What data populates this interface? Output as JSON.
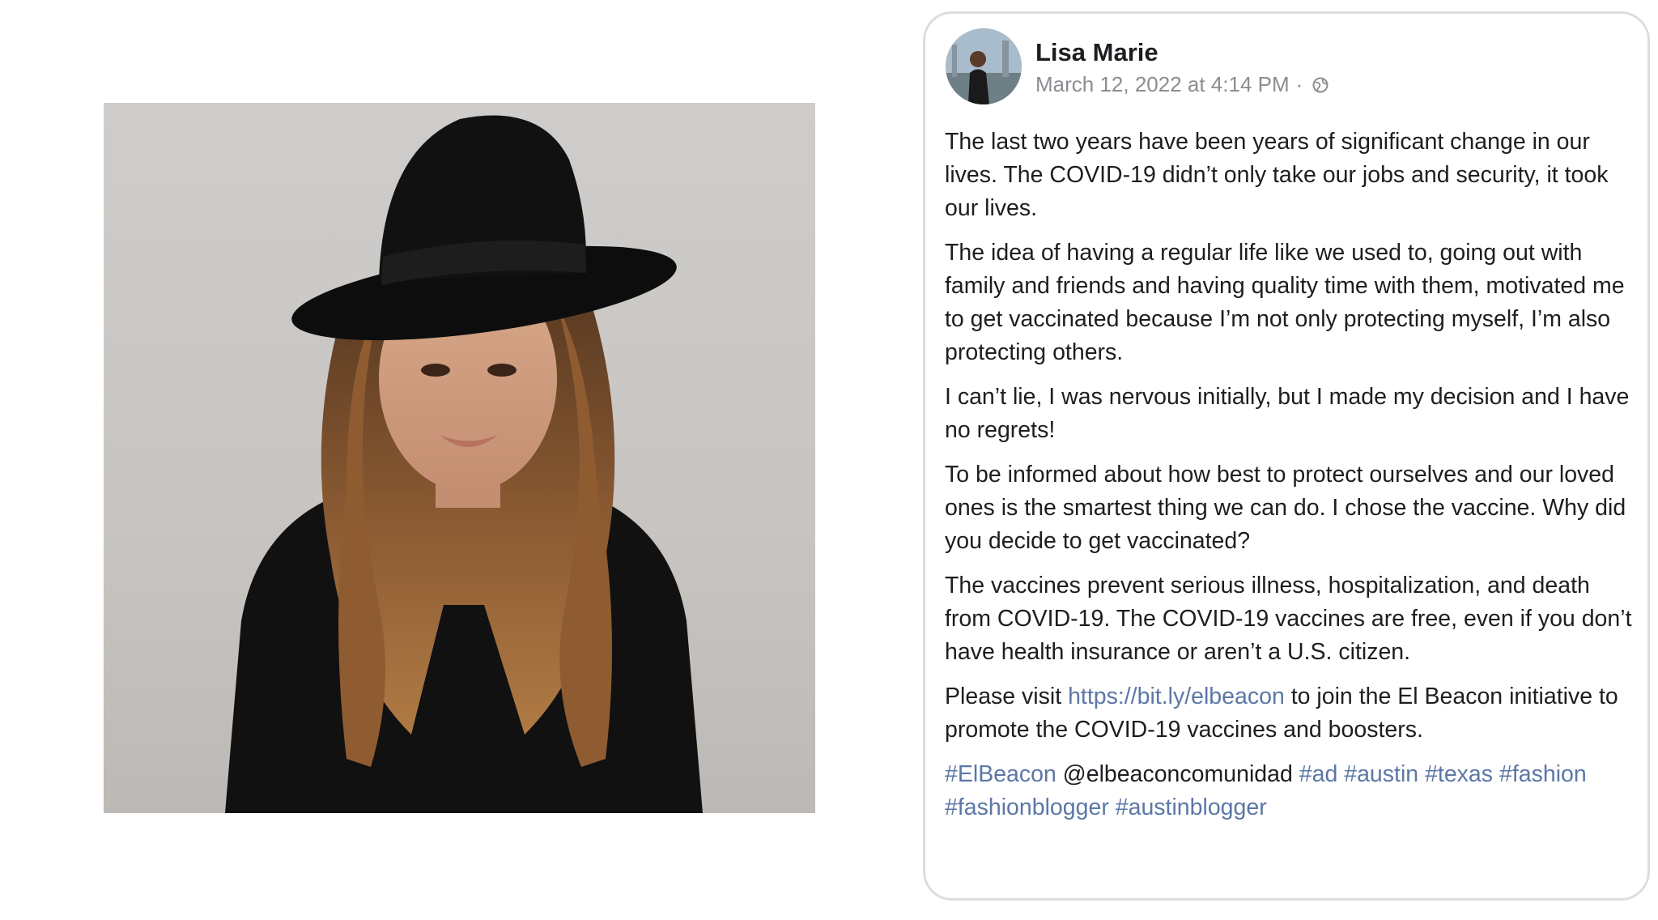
{
  "post": {
    "author": "Lisa Marie",
    "timestamp": "March 12, 2022 at 4:14 PM",
    "meta_separator": "·",
    "privacy_icon": "globe-icon",
    "paragraphs": [
      "The last two years have been years of significant change in our lives. The COVID-19 didn’t only take our jobs and security, it took our lives.",
      "The idea of having a regular life like we used to, going out with family and friends and having quality time with them, motivated me to get vaccinated because I’m not only protecting myself, I’m also protecting others.",
      "I can’t lie, I was nervous initially, but I made my decision and I have no regrets!",
      "To be informed about how best to protect ourselves and our loved ones is the smartest thing we can do. I chose the vaccine. Why did you decide to get vaccinated?",
      "The vaccines prevent serious illness, hospitalization, and death from COVID-19. The COVID-19 vaccines are free, even if you don’t have health insurance or aren’t a U.S. citizen."
    ],
    "cta_before": "Please visit ",
    "cta_link": "https://bit.ly/elbeacon",
    "cta_after": " to join the El Beacon initiative to promote the COVID-19 vaccines and boosters.",
    "tags": {
      "t1": "#ElBeacon",
      "mention": "@elbeaconcomunidad",
      "t2": "#ad",
      "t3": "#austin",
      "t4": "#texas",
      "t5": "#fashion",
      "t6": "#fashionblogger",
      "t7": "#austinblogger"
    }
  },
  "colors": {
    "link": "#5c77a6",
    "text": "#1c1e21",
    "meta": "#8a8d91",
    "card_border": "#dcdde1"
  }
}
